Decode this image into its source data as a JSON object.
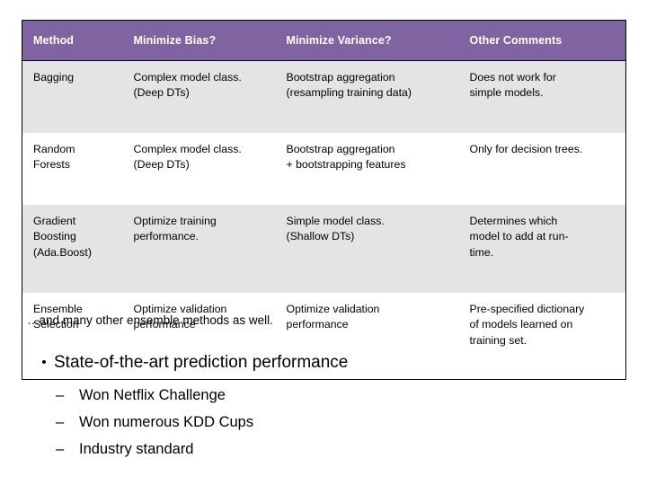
{
  "colors": {
    "header_bg": "#8064A2",
    "header_text": "#FFFFFF",
    "row_alt_bg": "#E4E4E4",
    "row_plain_bg": "#FFFFFF",
    "border": "#000000",
    "body_text": "#000000"
  },
  "table": {
    "headers": [
      "Method",
      "Minimize Bias?",
      "Minimize Variance?",
      "Other Comments"
    ],
    "rows": [
      {
        "method": [
          "Bagging"
        ],
        "minimize_bias": [
          "Complex model class.",
          "(Deep DTs)"
        ],
        "minimize_variance": [
          "Bootstrap aggregation",
          "(resampling training data)"
        ],
        "other_comments": [
          "Does not work for",
          "simple models."
        ]
      },
      {
        "method": [
          "Random",
          "Forests"
        ],
        "minimize_bias": [
          "Complex model class.",
          "(Deep DTs)"
        ],
        "minimize_variance": [
          "Bootstrap aggregation",
          "+ bootstrapping features"
        ],
        "other_comments": [
          "Only for decision trees."
        ]
      },
      {
        "method": [
          "Gradient",
          "Boosting",
          "(Ada.Boost)"
        ],
        "minimize_bias": [
          "Optimize training",
          "performance."
        ],
        "minimize_variance": [
          "Simple model class.",
          "(Shallow DTs)"
        ],
        "other_comments": [
          "Determines which",
          "model to add at run-",
          "time."
        ]
      },
      {
        "method": [
          "Ensemble",
          "Selection"
        ],
        "minimize_bias": [
          "Optimize validation",
          "performance"
        ],
        "minimize_variance": [
          "Optimize validation",
          "performance"
        ],
        "other_comments": [
          "Pre-specified dictionary",
          "of models learned on",
          "training set."
        ]
      }
    ]
  },
  "note": "…and many other ensemble methods as well.",
  "bullets": {
    "level1": {
      "marker": "•",
      "text": "State-of-the-art prediction performance"
    },
    "level2": [
      {
        "marker": "–",
        "text": "Won Netflix Challenge"
      },
      {
        "marker": "–",
        "text": "Won numerous KDD Cups"
      },
      {
        "marker": "–",
        "text": "Industry standard"
      }
    ]
  }
}
